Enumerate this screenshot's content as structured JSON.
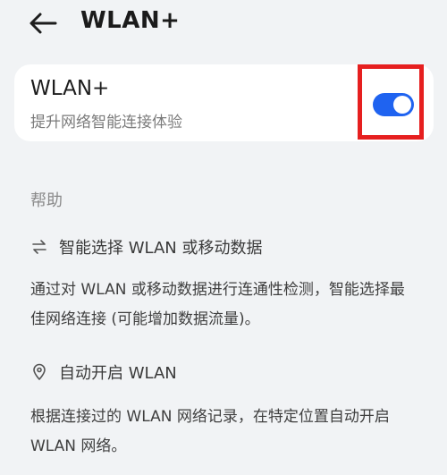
{
  "header": {
    "title": "WLAN+",
    "back_icon": "back-arrow-icon"
  },
  "wlan_card": {
    "title": "WLAN+",
    "subtitle": "提升网络智能连接体验",
    "toggle_state": "on",
    "toggle_color": "#1f63f0",
    "highlight_color": "#e61f1f"
  },
  "help": {
    "section_title": "帮助",
    "items": [
      {
        "icon": "swap-arrows-icon",
        "title": "智能选择 WLAN 或移动数据",
        "description": "通过对 WLAN 或移动数据进行连通性检测，智能选择最佳网络连接 (可能增加数据流量)。"
      },
      {
        "icon": "location-pin-icon",
        "title": "自动开启 WLAN",
        "description": "根据连接过的 WLAN 网络记录，在特定位置自动开启 WLAN 网络。"
      }
    ]
  }
}
